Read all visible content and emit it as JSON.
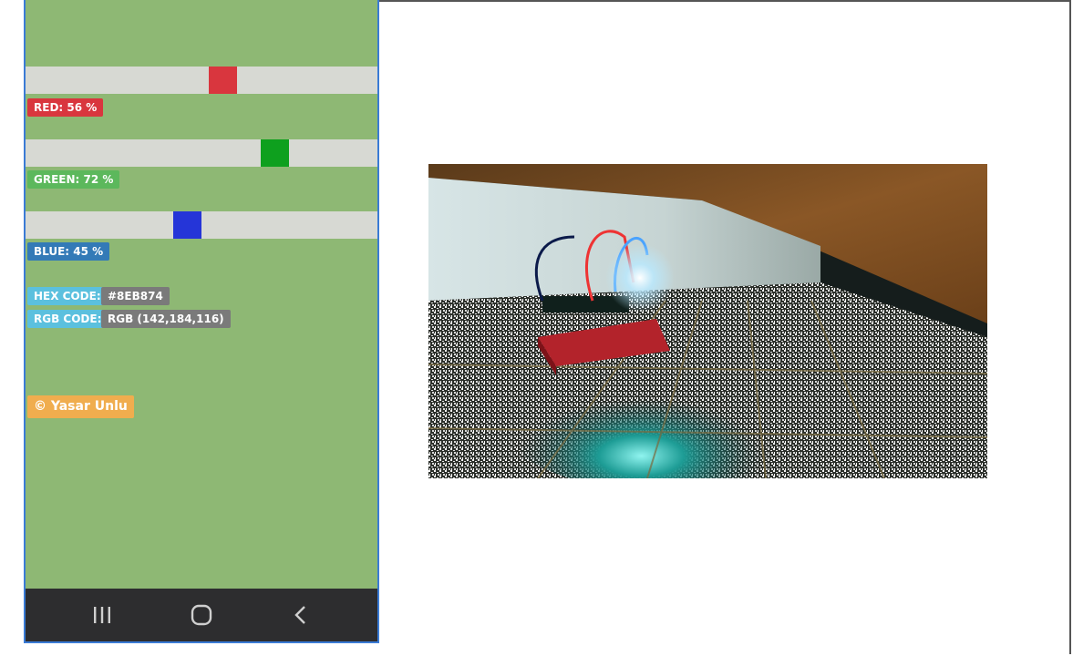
{
  "sliders": [
    {
      "label": "RED: 56 %",
      "percent": 56,
      "color": "#d9363e",
      "badge_color": "#d9363e"
    },
    {
      "label": "GREEN: 72 %",
      "percent": 72,
      "color": "#0ea01e",
      "badge_color": "#5cb85c"
    },
    {
      "label": "BLUE: 45 %",
      "percent": 45,
      "color": "#2535d8",
      "badge_color": "#337ab7"
    }
  ],
  "hex": {
    "label": "HEX CODE:",
    "value": "#8EB874"
  },
  "rgb": {
    "label": "RGB CODE:",
    "value": "RGB (142,184,116)"
  },
  "credit": "© Yasar Unlu",
  "background_color": "#8eb874",
  "navbar": {
    "icons": [
      "recent-apps-icon",
      "home-icon",
      "back-icon"
    ]
  },
  "photo": {
    "icon": "led-breadboard-photo"
  }
}
